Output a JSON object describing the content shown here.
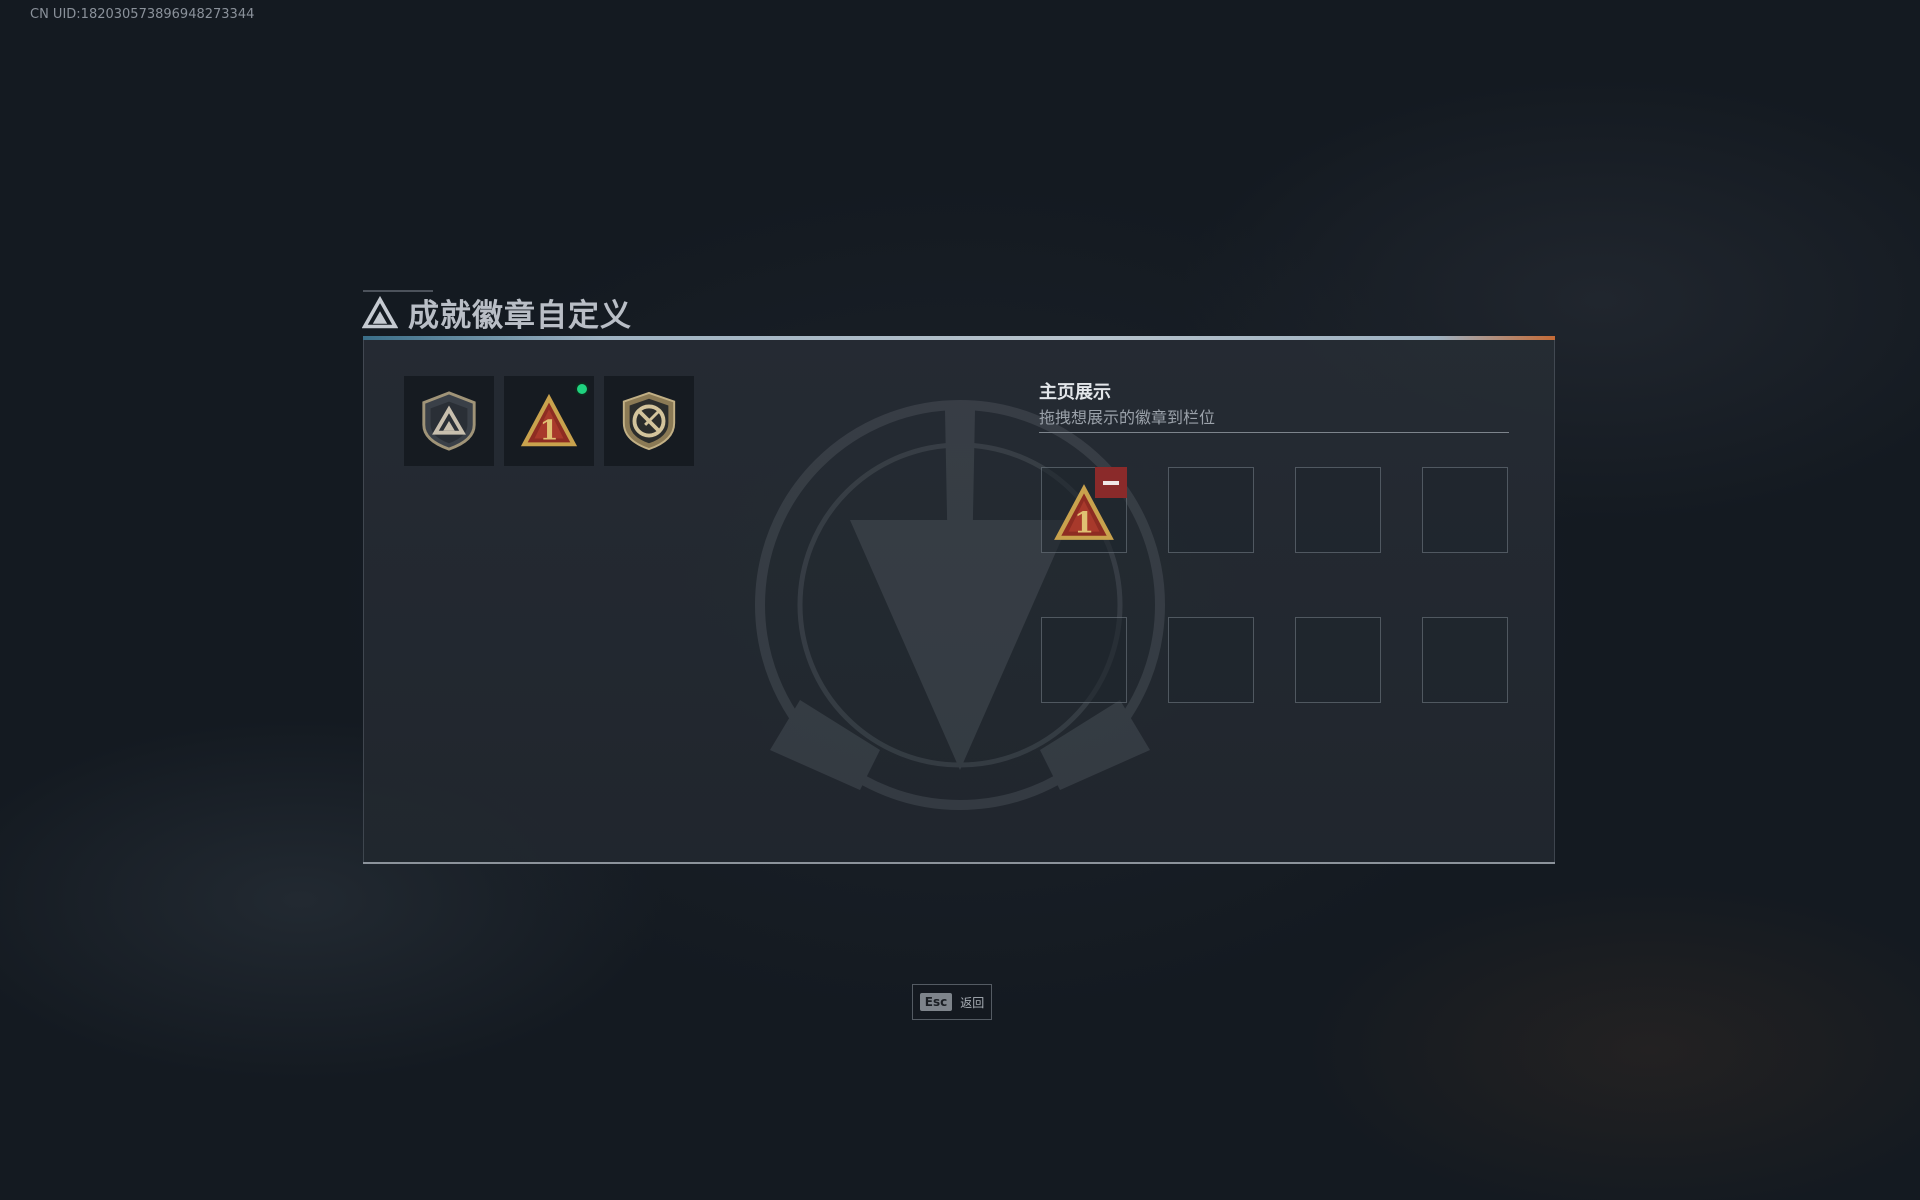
{
  "uid_text": "CN UID:182030573896948273344",
  "title": "成就徽章自定义",
  "owned_badges": [
    {
      "icon": "shield-triangle-badge-icon",
      "is_new": false
    },
    {
      "icon": "first-place-triangle-badge-icon",
      "is_new": true
    },
    {
      "icon": "no-knife-shield-badge-icon",
      "is_new": false
    }
  ],
  "showcase": {
    "title": "主页展示",
    "subtitle": "拖拽想展示的徽章到栏位",
    "slots": [
      {
        "badge": "first-place-triangle-badge-icon",
        "removable": true
      },
      {
        "badge": null
      },
      {
        "badge": null
      },
      {
        "badge": null
      },
      {
        "badge": null
      },
      {
        "badge": null
      },
      {
        "badge": null
      },
      {
        "badge": null
      }
    ]
  },
  "esc": {
    "key": "Esc",
    "label": "返回"
  },
  "colors": {
    "new_dot": "#1fd37f",
    "remove": "#8a2a2a",
    "badge_gold": "#c9a24d",
    "badge_red": "#8e2c22"
  }
}
